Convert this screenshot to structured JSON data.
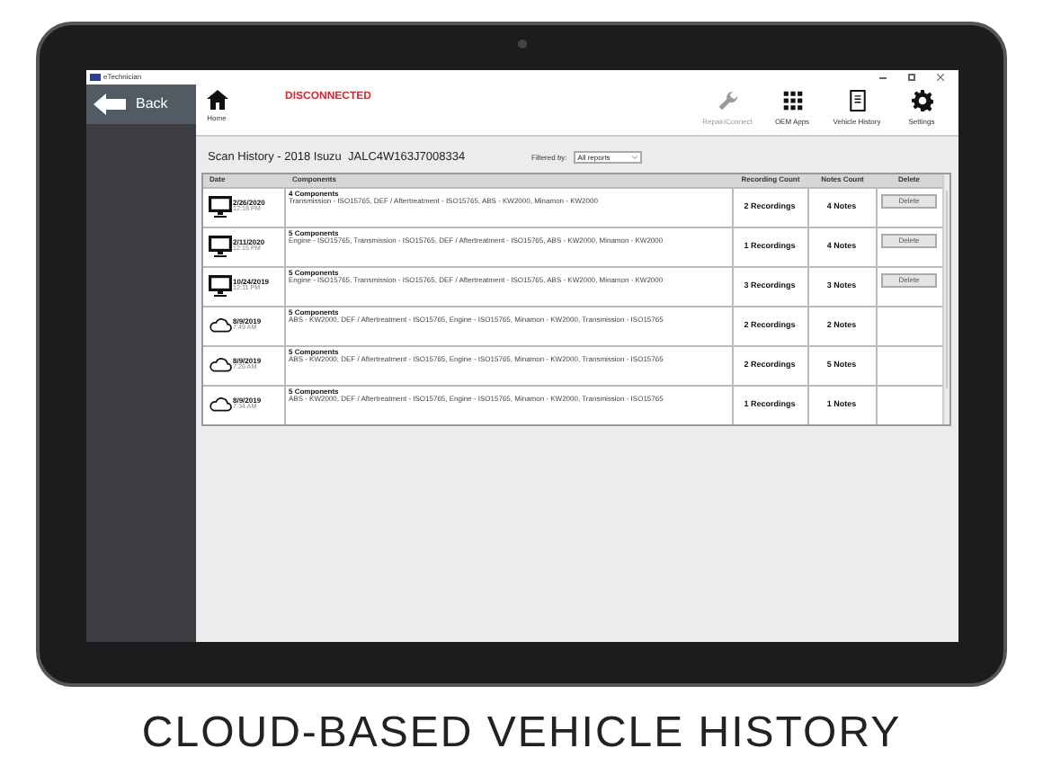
{
  "window": {
    "title": "eTechnician"
  },
  "sidebar": {
    "back_label": "Back"
  },
  "toolbar": {
    "home_label": "Home",
    "connection_status": "DISCONNECTED",
    "buttons": [
      {
        "kind": "wrench",
        "label": "Repair/Connect",
        "disabled": true
      },
      {
        "kind": "grid",
        "label": "OEM Apps",
        "disabled": false
      },
      {
        "kind": "book",
        "label": "Vehicle History",
        "disabled": false
      },
      {
        "kind": "gear",
        "label": "Settings",
        "disabled": false
      }
    ]
  },
  "title": "Scan History - 2018 Isuzu  JALC4W163J7008334",
  "filter": {
    "label": "Filtered by:",
    "value": "All reports"
  },
  "table": {
    "columns": [
      "Date",
      "Components",
      "Recording Count",
      "Notes Count",
      "Delete"
    ],
    "rows": [
      {
        "kind": "desktop",
        "date": "2/26/2020",
        "time": "12:18 PM",
        "count": "4 Components",
        "components": "Transmission - ISO15765, DEF / Aftertreatment - ISO15765, ABS - KW2000, Minamon - KW2000",
        "recordings": "2 Recordings",
        "notes": "4 Notes",
        "delete": "Delete"
      },
      {
        "kind": "desktop",
        "date": "2/11/2020",
        "time": "12:15 PM",
        "count": "5 Components",
        "components": "Engine - ISO15765, Transmission - ISO15765, DEF / Aftertreatment - ISO15765, ABS - KW2000, Minamon - KW2000",
        "recordings": "1 Recordings",
        "notes": "4 Notes",
        "delete": "Delete"
      },
      {
        "kind": "desktop",
        "date": "10/24/2019",
        "time": "12:11 PM",
        "count": "5 Components",
        "components": "Engine - ISO15765, Transmission - ISO15765, DEF / Aftertreatment - ISO15765, ABS - KW2000, Minamon - KW2000",
        "recordings": "3 Recordings",
        "notes": "3 Notes",
        "delete": "Delete"
      },
      {
        "kind": "cloud",
        "date": "8/9/2019",
        "time": "7:49 AM",
        "count": "5 Components",
        "components": "ABS - KW2000, DEF / Aftertreatment - ISO15765, Engine - ISO15765, Minamon - KW2000, Transmission - ISO15765",
        "recordings": "2 Recordings",
        "notes": "2 Notes"
      },
      {
        "kind": "cloud",
        "date": "8/9/2019",
        "time": "7:26 AM",
        "count": "5 Components",
        "components": "ABS - KW2000, DEF / Aftertreatment - ISO15765, Engine - ISO15765, Minamon - KW2000, Transmission - ISO15765",
        "recordings": "2 Recordings",
        "notes": "5 Notes"
      },
      {
        "kind": "cloud",
        "date": "8/9/2019",
        "time": "7:34 AM",
        "count": "5 Components",
        "components": "ABS - KW2000, DEF / Aftertreatment - ISO15765, Engine - ISO15765, Minamon - KW2000, Transmission - ISO15765",
        "recordings": "1 Recordings",
        "notes": "1 Notes"
      }
    ]
  },
  "caption": "CLOUD-BASED VEHICLE HISTORY"
}
